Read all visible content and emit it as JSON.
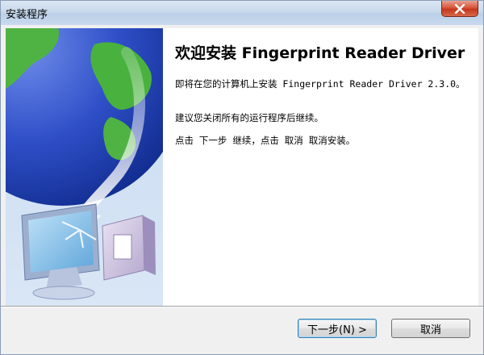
{
  "window": {
    "title": "安装程序",
    "close_icon": "close-icon"
  },
  "banner": {
    "image": "globe-and-computer-illustration"
  },
  "main": {
    "heading": "欢迎安装 Fingerprint Reader Driver",
    "paragraph1": "即将在您的计算机上安装 Fingerprint Reader Driver 2.3.0。",
    "paragraph2": "建议您关闭所有的运行程序后继续。",
    "paragraph3": "点击 下一步 继续，点击 取消 取消安装。"
  },
  "buttons": {
    "next_label": "下一步(N) >",
    "cancel_label": "取消"
  }
}
